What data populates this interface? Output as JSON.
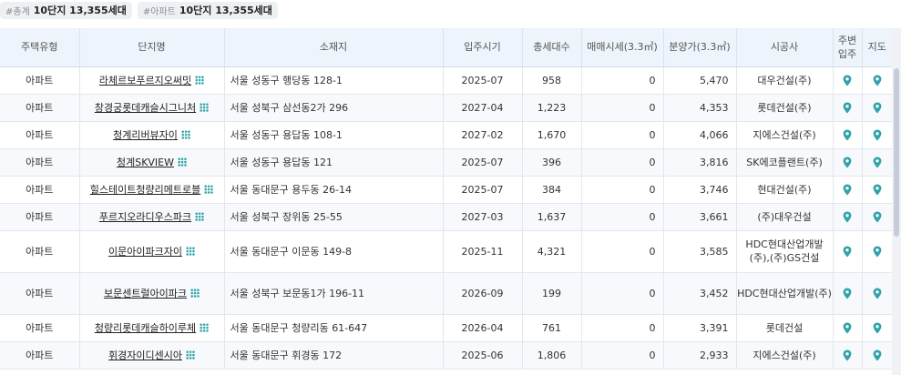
{
  "summary": {
    "total_tag": "#총계",
    "total_value": "10단지 13,355세대",
    "apt_tag": "#아파트",
    "apt_value": "10단지 13,355세대"
  },
  "columns": [
    "주택유형",
    "단지명",
    "소재지",
    "입주시기",
    "총세대수",
    "매매시세(3.3㎡)",
    "분양가(3.3㎡)",
    "시공사",
    "주변 입주",
    "지도"
  ],
  "rows": [
    {
      "type": "아파트",
      "name": "라체르보푸르지오써밋",
      "address": "서울 성동구 행당동 128-1",
      "move_in": "2025-07",
      "units": "958",
      "market_price": "0",
      "sale_price": "5,470",
      "builder": "대우건설(주)"
    },
    {
      "type": "아파트",
      "name": "창경궁롯데캐슬시그니처",
      "address": "서울 성북구 삼선동2가 296",
      "move_in": "2027-04",
      "units": "1,223",
      "market_price": "0",
      "sale_price": "4,353",
      "builder": "롯데건설(주)"
    },
    {
      "type": "아파트",
      "name": "청계리버뷰자이",
      "address": "서울 성동구 용답동 108-1",
      "move_in": "2027-02",
      "units": "1,670",
      "market_price": "0",
      "sale_price": "4,066",
      "builder": "지에스건설(주)"
    },
    {
      "type": "아파트",
      "name": "청계SKVIEW",
      "address": "서울 성동구 용답동 121",
      "move_in": "2025-07",
      "units": "396",
      "market_price": "0",
      "sale_price": "3,816",
      "builder": "SK에코플랜트(주)"
    },
    {
      "type": "아파트",
      "name": "힐스테이트청량리메트로블",
      "address": "서울 동대문구 용두동 26-14",
      "move_in": "2025-07",
      "units": "384",
      "market_price": "0",
      "sale_price": "3,746",
      "builder": "현대건설(주)"
    },
    {
      "type": "아파트",
      "name": "푸르지오라디우스파크",
      "address": "서울 성북구 장위동 25-55",
      "move_in": "2027-03",
      "units": "1,637",
      "market_price": "0",
      "sale_price": "3,661",
      "builder": "(주)대우건설"
    },
    {
      "type": "아파트",
      "name": "이문아이파크자이",
      "address": "서울 동대문구 이문동 149-8",
      "move_in": "2025-11",
      "units": "4,321",
      "market_price": "0",
      "sale_price": "3,585",
      "builder": "HDC현대산업개발(주),(주)GS건설"
    },
    {
      "type": "아파트",
      "name": "보문센트럴아이파크",
      "address": "서울 성북구 보문동1가 196-11",
      "move_in": "2026-09",
      "units": "199",
      "market_price": "0",
      "sale_price": "3,452",
      "builder": "HDC현대산업개발(주)"
    },
    {
      "type": "아파트",
      "name": "청량리롯데캐슬하이루체",
      "address": "서울 동대문구 청량리동 61-647",
      "move_in": "2026-04",
      "units": "761",
      "market_price": "0",
      "sale_price": "3,391",
      "builder": "롯데건설"
    },
    {
      "type": "아파트",
      "name": "휘경자이디센시아",
      "address": "서울 동대문구 휘경동 172",
      "move_in": "2025-06",
      "units": "1,806",
      "market_price": "0",
      "sale_price": "2,933",
      "builder": "지에스건설(주)"
    }
  ],
  "colors": {
    "accent": "#2fa3a8",
    "header_bg": "#eef4fb"
  },
  "icons": {
    "complex_icon": "apartment-grid-icon",
    "location_icon": "map-pin-icon"
  }
}
